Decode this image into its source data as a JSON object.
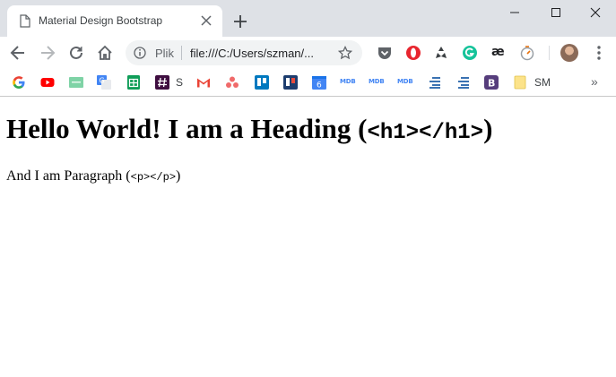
{
  "tab": {
    "title": "Material Design Bootstrap"
  },
  "toolbar": {
    "scheme": "Plik",
    "url": "file:///C:/Users/szman/..."
  },
  "toolbar_extensions": [
    "pocket-icon",
    "opera-icon",
    "recycle-icon",
    "grammarly-icon",
    "ae-icon",
    "stopwatch-icon"
  ],
  "toolbar_ae_text": "æ",
  "bookmarks": {
    "items": [
      {
        "icon": "google-icon",
        "label": ""
      },
      {
        "icon": "youtube-icon",
        "label": ""
      },
      {
        "icon": "green-app-icon",
        "label": ""
      },
      {
        "icon": "google-translate-icon",
        "label": ""
      },
      {
        "icon": "google-sheets-icon",
        "label": ""
      },
      {
        "icon": "slack-icon",
        "label": "S"
      },
      {
        "icon": "gmail-icon",
        "label": ""
      },
      {
        "icon": "asana-icon",
        "label": ""
      },
      {
        "icon": "trello-icon",
        "label": ""
      },
      {
        "icon": "trello-dark-icon",
        "label": ""
      },
      {
        "icon": "calendar-icon",
        "label": "6"
      },
      {
        "icon": "mdb-icon",
        "label": "MDB"
      },
      {
        "icon": "mdb-icon",
        "label": "MDB"
      },
      {
        "icon": "mdb-icon",
        "label": "MDB"
      },
      {
        "icon": "list-icon",
        "label": ""
      },
      {
        "icon": "list-icon",
        "label": ""
      },
      {
        "icon": "bootstrap-icon",
        "label": "B"
      },
      {
        "icon": "folder-icon",
        "label": "SM"
      }
    ],
    "overflow": "»"
  },
  "content": {
    "heading_text": "Hello World! I am a Heading (",
    "heading_code": "<h1></h1>",
    "heading_close": ")",
    "paragraph_text": "And I am Paragraph (",
    "paragraph_code": "<p></p>",
    "paragraph_close": ")"
  },
  "colors": {
    "tabstrip": "#dee1e6",
    "omnibox": "#f1f3f4",
    "youtube": "#ff0000",
    "gmail": "#ea4335",
    "trello": "#0079bf",
    "bootstrap": "#563d7c",
    "mdb": "#4285f4"
  }
}
